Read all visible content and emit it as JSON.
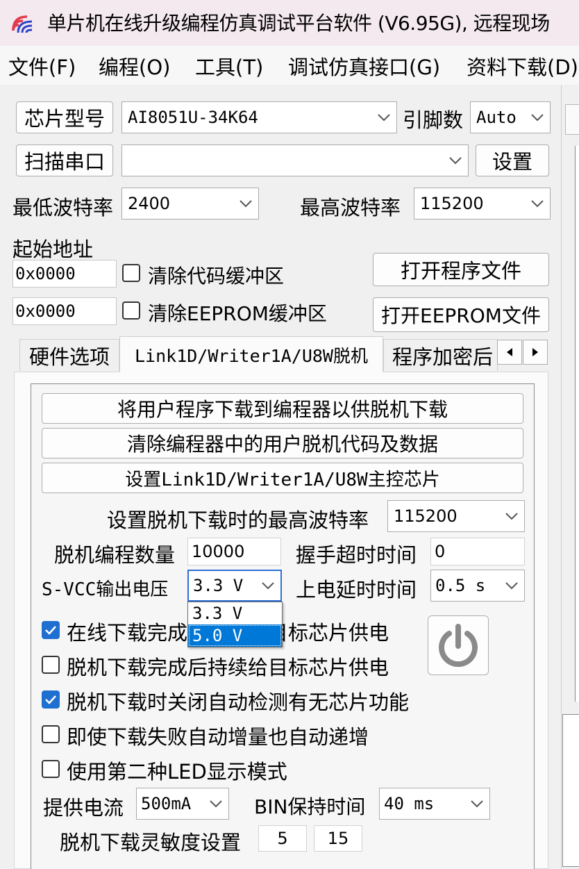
{
  "window": {
    "title": "单片机在线升级编程仿真调试平台软件 (V6.95G), 远程现场"
  },
  "menu": [
    "文件(F)",
    "编程(O)",
    "工具(T)",
    "调试仿真接口(G)",
    "资料下载(D)"
  ],
  "chip": {
    "button": "芯片型号",
    "value": "AI8051U-34K64",
    "pins_label": "引脚数",
    "pins_value": "Auto"
  },
  "port": {
    "scan_button": "扫描串口",
    "value": "",
    "settings_button": "设置"
  },
  "baud": {
    "min_label": "最低波特率",
    "min_value": "2400",
    "max_label": "最高波特率",
    "max_value": "115200"
  },
  "start_address": {
    "label": "起始地址",
    "code_addr": "0x0000",
    "clear_code": "清除代码缓冲区",
    "clear_code_checked": true,
    "eeprom_addr": "0x0000",
    "clear_eeprom": "清除EEPROM缓冲区",
    "clear_eeprom_checked": true,
    "open_program": "打开程序文件",
    "open_eeprom": "打开EEPROM文件"
  },
  "tabs": [
    "硬件选项",
    "Link1D/Writer1A/U8W脱机",
    "程序加密后"
  ],
  "active_tab": 1,
  "offline": {
    "download_btn": "将用户程序下载到编程器以供脱机下载",
    "clear_btn": "清除编程器中的用户脱机代码及数据",
    "setup_btn": "设置Link1D/Writer1A/U8W主控芯片",
    "max_baud_label": "设置脱机下载时的最高波特率",
    "max_baud_value": "115200",
    "count_label": "脱机编程数量",
    "count_value": "10000",
    "handshake_label": "握手超时时间",
    "handshake_value": "0",
    "svcc_label": "S-VCC输出电压",
    "svcc_value": "3.3 V",
    "svcc_options": [
      "3.3 V",
      "5.0 V"
    ],
    "power_delay_label": "上电延时时间",
    "power_delay_value": "0.5 s",
    "checkboxes": [
      {
        "label": "在线下载完成后持续给目标芯片供电",
        "checked": true
      },
      {
        "label": "脱机下载完成后持续给目标芯片供电",
        "checked": false
      },
      {
        "label": "脱机下载时关闭自动检测有无芯片功能",
        "checked": true
      },
      {
        "label": "即使下载失败自动增量也自动递增",
        "checked": false
      },
      {
        "label": "使用第二种LED显示模式",
        "checked": false
      }
    ],
    "current_label": "提供电流",
    "current_value": "500mA",
    "bin_hold_label": "BIN保持时间",
    "bin_hold_value": "40 ms",
    "sensitivity_label": "脱机下载灵敏度设置",
    "sensitivity_values": [
      "5",
      "15"
    ]
  },
  "colors": {
    "accent": "#1f6fd1",
    "title_bg": "#f3e9ee",
    "selection": "#0078d7"
  }
}
